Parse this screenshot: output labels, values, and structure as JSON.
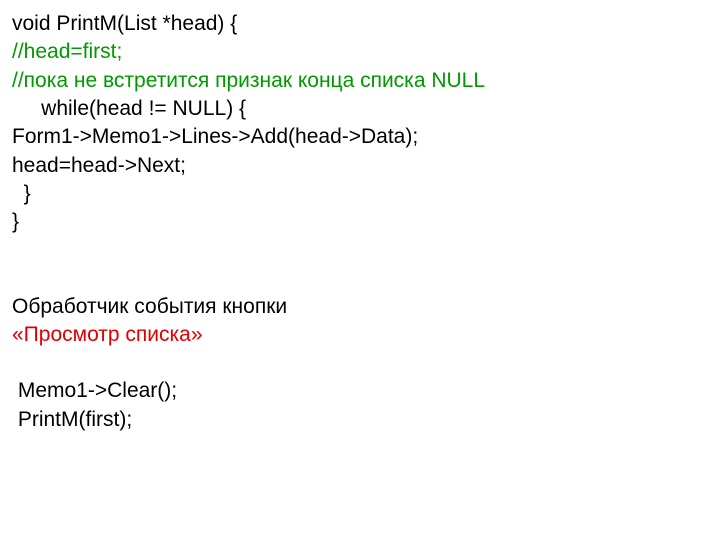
{
  "lines": {
    "l1": "void PrintM(List *head) {",
    "l2": "//head=first;",
    "l3": "//пока не встретится признак конца списка NULL",
    "l4": "     while(head != NULL) {",
    "l5": "Form1->Memo1->Lines->Add(head->Data);",
    "l6": "head=head->Next;",
    "l7": "  }",
    "l8": "}",
    "l9": "Обработчик события кнопки",
    "l10": "«Просмотр списка»",
    "l11": " Memo1->Clear();",
    "l12": " PrintM(first);"
  }
}
